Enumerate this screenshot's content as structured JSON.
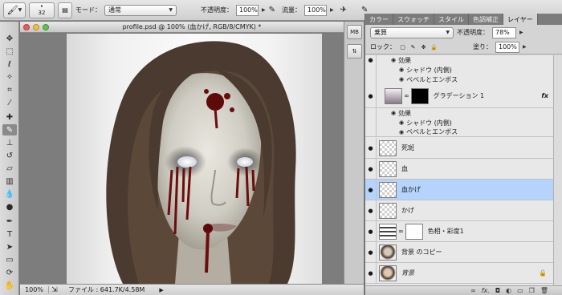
{
  "options_bar": {
    "brush_size": "32",
    "mode_label": "モード：",
    "mode_value": "通常",
    "opacity_label": "不透明度：",
    "opacity_value": "100%",
    "flow_label": "流量：",
    "flow_value": "100%"
  },
  "document": {
    "title": "profile.psd @ 100% (血かげ, RGB/8/CMYK) *",
    "zoom": "100%",
    "file_info": "ファイル : 641.7K/4.58M"
  },
  "panel_strip": {
    "top_button": "MB"
  },
  "layers_panel": {
    "tabs": [
      {
        "label": "カラー"
      },
      {
        "label": "スウォッチ"
      },
      {
        "label": "スタイル"
      },
      {
        "label": "色調補正"
      },
      {
        "label": "レイヤー"
      }
    ],
    "blend_mode": "乗算",
    "opacity_label": "不透明度：",
    "opacity_value": "78%",
    "lock_label": "ロック：",
    "fill_label": "塗り：",
    "fill_value": "100%",
    "effects_label": "効果",
    "effect_shadow": "シャドウ (内側)",
    "effect_bevel": "ベベルとエンボス",
    "layers": [
      {
        "name": "グラデーション 1",
        "fx": "fx"
      },
      {
        "name": "死斑"
      },
      {
        "name": "血"
      },
      {
        "name": "血かげ"
      },
      {
        "name": "かげ"
      },
      {
        "name": "色相・彩度1"
      },
      {
        "name": "背景 のコピー"
      },
      {
        "name": "背景"
      }
    ]
  },
  "colors": {
    "selection": "#b5d3fb",
    "close": "#ee5a52",
    "minimize": "#f4be3c",
    "zoom": "#5fc24a"
  },
  "icons": [
    "brush-icon",
    "eye-icon",
    "lock-icon",
    "link-icon",
    "trash-icon",
    "new-layer-icon",
    "folder-icon",
    "mask-icon",
    "fx-icon"
  ]
}
